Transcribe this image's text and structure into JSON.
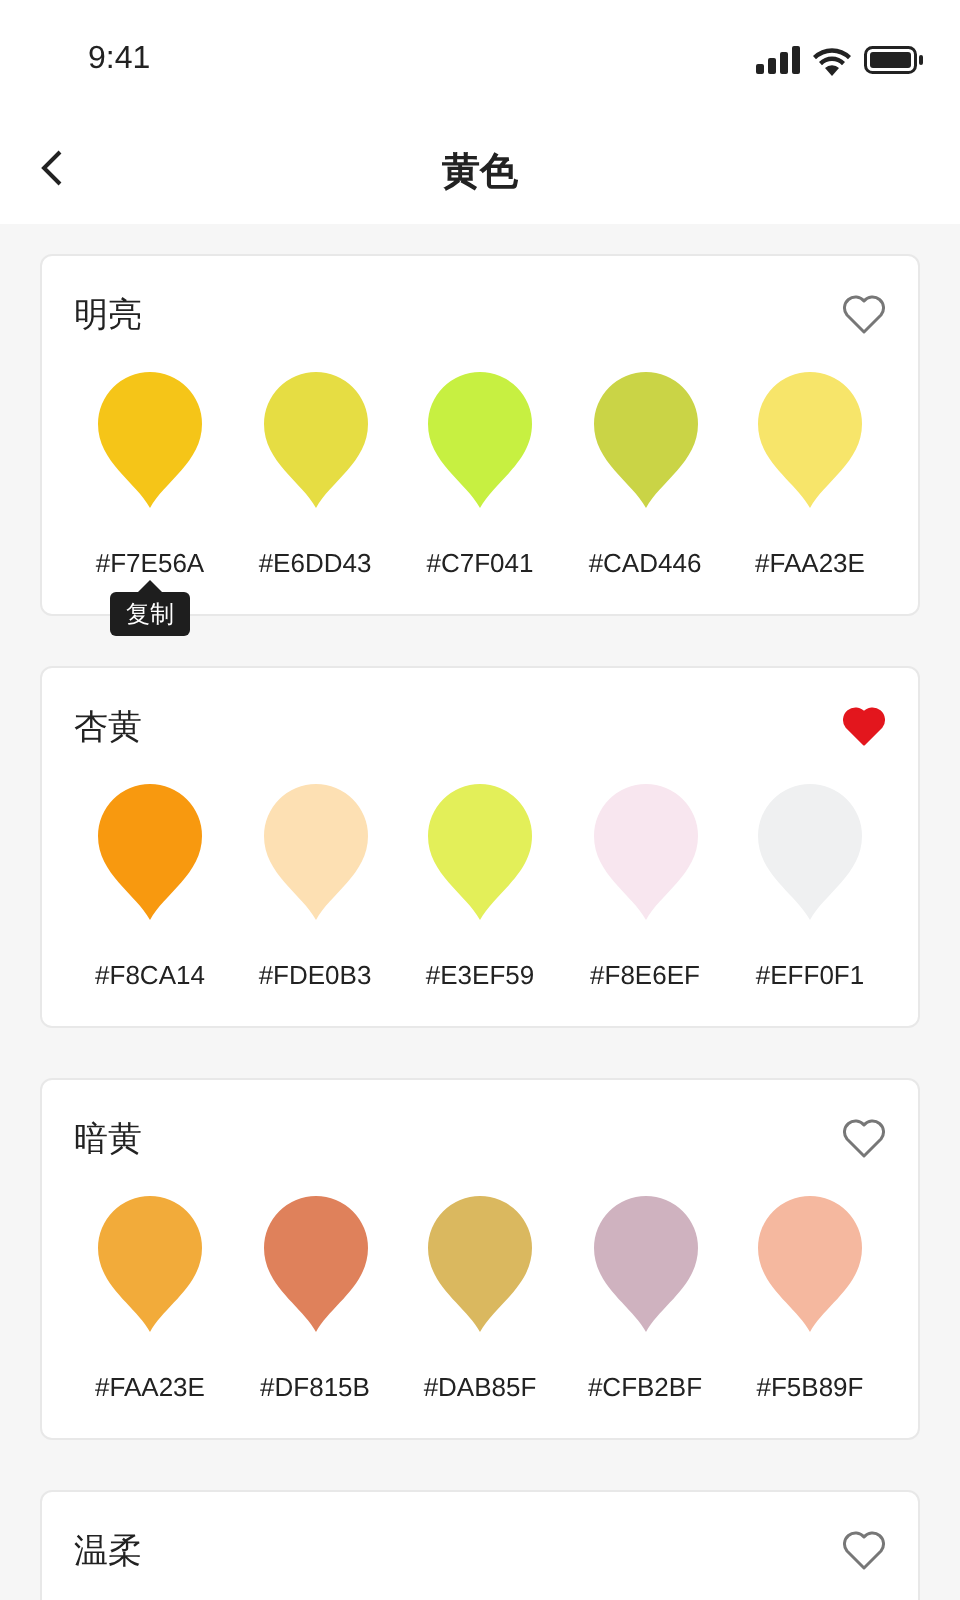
{
  "status_bar": {
    "time": "9:41"
  },
  "header": {
    "title": "黄色"
  },
  "groups": [
    {
      "name": "明亮",
      "favorite": false,
      "swatches": [
        {
          "color": "#f5c518",
          "hex": "#F7E56A",
          "tooltip": "复制"
        },
        {
          "color": "#e6dd43",
          "hex": "#E6DD43"
        },
        {
          "color": "#c7f041",
          "hex": "#C7F041"
        },
        {
          "color": "#cad446",
          "hex": "#CAD446"
        },
        {
          "color": "#f7e56a",
          "hex": "#FAA23E"
        }
      ]
    },
    {
      "name": "杏黄",
      "favorite": true,
      "swatches": [
        {
          "color": "#f8990f",
          "hex": "#F8CA14"
        },
        {
          "color": "#fde0b3",
          "hex": "#FDE0B3"
        },
        {
          "color": "#e3ef59",
          "hex": "#E3EF59"
        },
        {
          "color": "#f8e6ef",
          "hex": "#F8E6EF"
        },
        {
          "color": "#eff0f1",
          "hex": "#EFF0F1"
        }
      ]
    },
    {
      "name": "暗黄",
      "favorite": false,
      "swatches": [
        {
          "color": "#f2ab3a",
          "hex": "#FAA23E"
        },
        {
          "color": "#df815b",
          "hex": "#DF815B"
        },
        {
          "color": "#dab85f",
          "hex": "#DAB85F"
        },
        {
          "color": "#cfb2bf",
          "hex": "#CFB2BF"
        },
        {
          "color": "#f5b89f",
          "hex": "#F5B89F"
        }
      ]
    },
    {
      "name": "温柔",
      "favorite": false
    }
  ]
}
